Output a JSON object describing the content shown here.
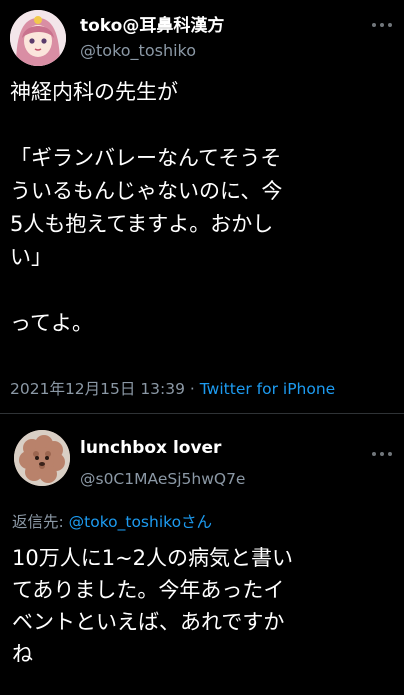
{
  "main_tweet": {
    "display_name": "toko@耳鼻科漢方",
    "handle": "@toko_toshiko",
    "text": "神経内科の先生が\n\n「ギランバレーなんてそうそ\nういるもんじゃないのに、今\n5人も抱えてますよ。おかし\nい」\n\nってよ。",
    "date": "2021年12月15日 13:39",
    "separator": " · ",
    "source": "Twitter for iPhone"
  },
  "reply_tweet": {
    "display_name": "lunchbox lover",
    "handle": "@s0C1MAeSj5hwQ7e",
    "reply_prefix": "返信先: ",
    "reply_mention": "@toko_toshiko",
    "reply_suffix": "さん",
    "text": "10万人に1~2人の病気と書い\nてありました。今年あったイ\nベントといえば、あれですか\nね"
  },
  "icons": {
    "more": "more-horizontal-icon",
    "avatar_main": "anime-avatar",
    "avatar_reply": "poodle-avatar"
  },
  "colors": {
    "background": "#000000",
    "text": "#ffffff",
    "secondary": "#8b98a5",
    "link": "#1d9bf0",
    "divider": "#2f3336"
  }
}
